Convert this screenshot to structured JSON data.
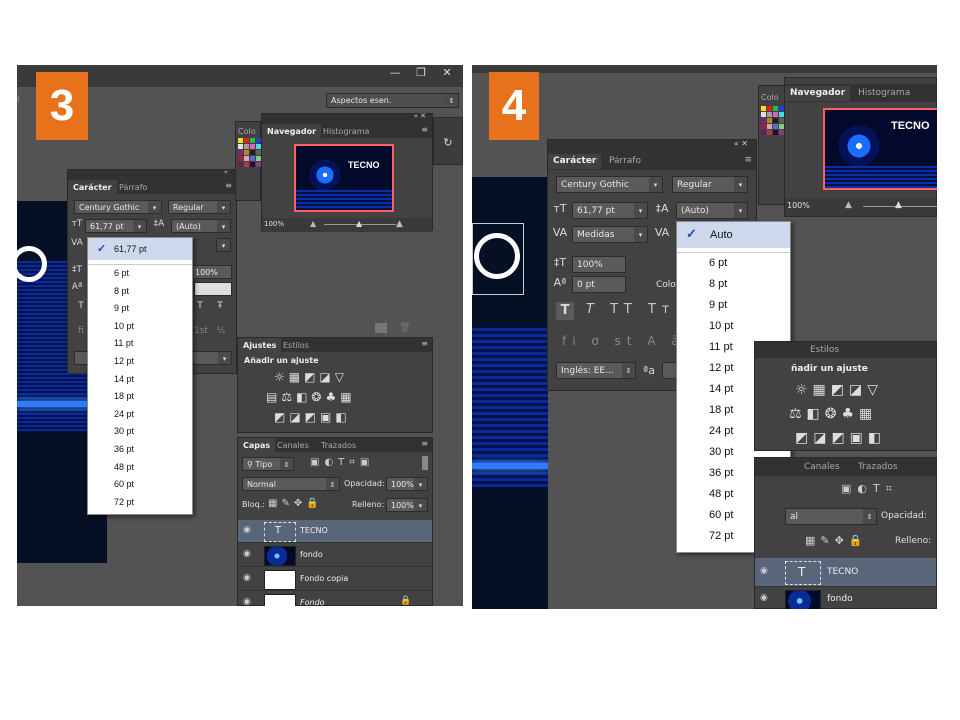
{
  "step3": {
    "badge": "3",
    "workspace": "Aspectos esen.",
    "window_buttons": [
      "—",
      "❐",
      "✕"
    ],
    "character_panel": {
      "tab_active": "Carácter",
      "tab_other": "Párrafo",
      "font": "Century Gothic",
      "style": "Regular",
      "size": "61,77 pt",
      "leading": "(Auto)",
      "scale": "100%"
    },
    "size_menu": {
      "selected": "61,77 pt",
      "options": [
        "6 pt",
        "8 pt",
        "9 pt",
        "10 pt",
        "11 pt",
        "12 pt",
        "14 pt",
        "18 pt",
        "24 pt",
        "30 pt",
        "36 pt",
        "48 pt",
        "60 pt",
        "72 pt"
      ]
    },
    "navigator": {
      "tab_active": "Navegador",
      "tab_other": "Histograma",
      "zoom": "100%",
      "image_text": "TECNO"
    },
    "color_tab": "Colo",
    "adjustments": {
      "tab_active": "Ajustes",
      "tab_other": "Estilos",
      "title": "Añadir un ajuste"
    },
    "layers": {
      "tabs": [
        "Capas",
        "Canales",
        "Trazados"
      ],
      "filter": "Tipo",
      "blend": "Normal",
      "opacity_label": "Opacidad:",
      "opacity": "100%",
      "lock_label": "Bloq.:",
      "fill_label": "Relleno:",
      "fill": "100%",
      "items": [
        "TECNO",
        "fondo",
        "Fondo copia",
        "Fondo"
      ]
    }
  },
  "step4": {
    "badge": "4",
    "character_panel": {
      "tab_active": "Carácter",
      "tab_other": "Párrafo",
      "font": "Century Gothic",
      "style": "Regular",
      "size": "61,77 pt",
      "leading": "(Auto)",
      "kerning": "Medidas",
      "scale": "100%",
      "baseline": "0 pt",
      "color_label": "Colo",
      "language": "Inglés: EE..."
    },
    "leading_menu": {
      "selected": "Auto",
      "options": [
        "6 pt",
        "8 pt",
        "9 pt",
        "10 pt",
        "11 pt",
        "12 pt",
        "14 pt",
        "18 pt",
        "24 pt",
        "30 pt",
        "36 pt",
        "48 pt",
        "60 pt",
        "72 pt"
      ]
    },
    "navigator": {
      "tab_active": "Navegador",
      "tab_other": "Histograma",
      "zoom": "100%",
      "image_text": "TECNO"
    },
    "color_tab": "Colo",
    "adjustments": {
      "tab_other": "Estilos",
      "title": "ñadir un ajuste"
    },
    "layers": {
      "tabs": [
        "Canales",
        "Trazados"
      ],
      "blend": "al",
      "opacity_label": "Opacidad:",
      "fill_label": "Relleno:",
      "items": [
        "TECNO",
        "fondo"
      ]
    }
  },
  "colors": {
    "badge": "#e8721c",
    "ps_bg": "#535353",
    "panel": "#424242",
    "check": "#1f4fb5"
  }
}
